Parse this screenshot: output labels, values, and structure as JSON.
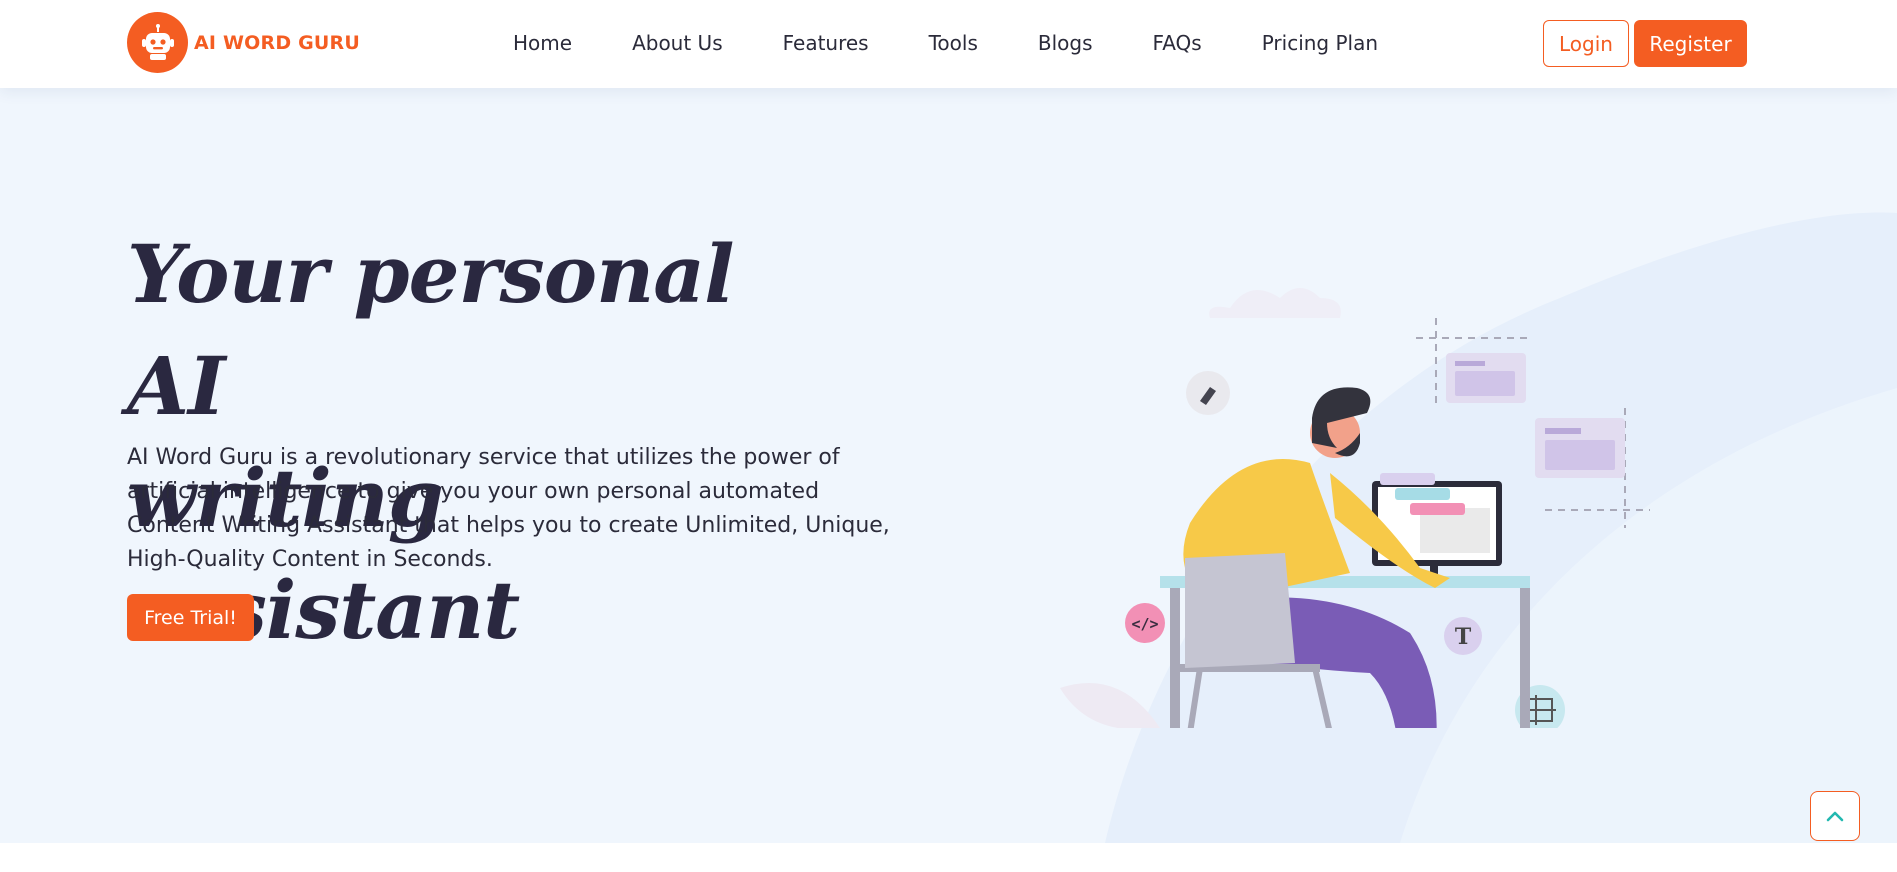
{
  "brand": {
    "name": "AI WORD GURU",
    "color": "#f45d22"
  },
  "nav": {
    "items": [
      {
        "label": "Home"
      },
      {
        "label": "About Us"
      },
      {
        "label": "Features"
      },
      {
        "label": "Tools"
      },
      {
        "label": "Blogs"
      },
      {
        "label": "FAQs"
      },
      {
        "label": "Pricing Plan"
      }
    ]
  },
  "auth": {
    "login_label": "Login",
    "register_label": "Register"
  },
  "hero": {
    "title_line1": "Your personal AI",
    "title_line2": "writing assistant",
    "description": "AI Word Guru is a revolutionary service that utilizes the power of artificial intelligence to give you your own personal automated Content Writing Assistant that helps you to create Unlimited, Unique, High-Quality Content in Seconds.",
    "cta_label": "Free Trial!",
    "background": "#f0f6fd"
  },
  "icons": {
    "logo": "robot-icon",
    "scroll_top": "chevron-up-icon"
  }
}
